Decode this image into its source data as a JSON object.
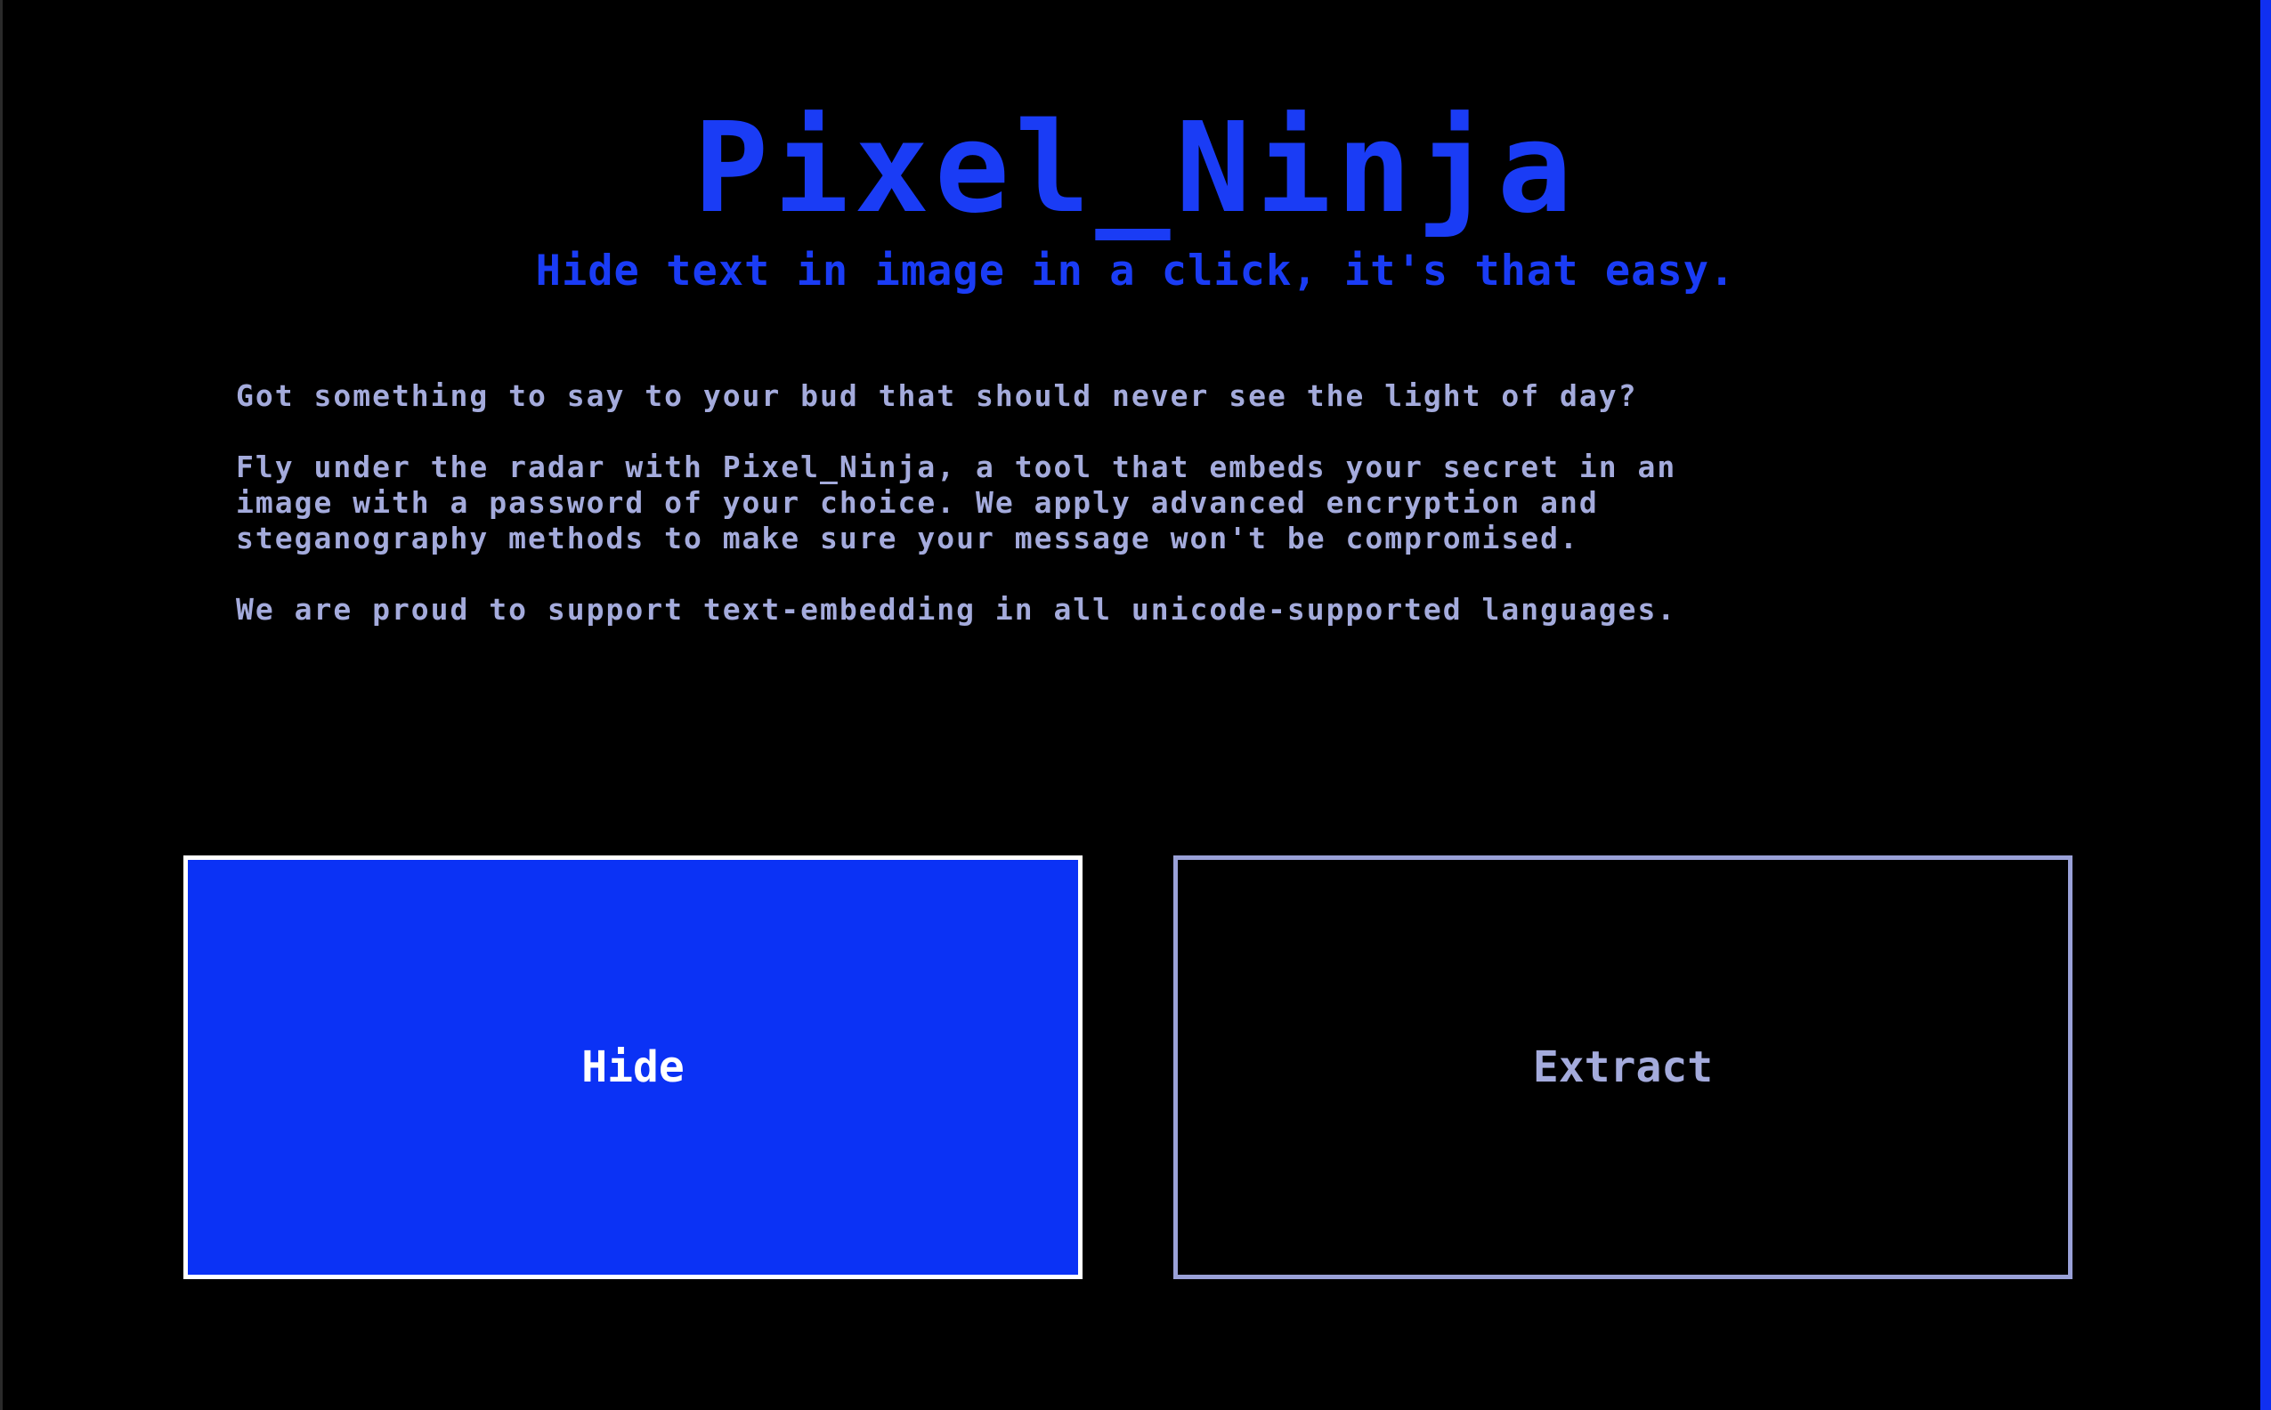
{
  "app": {
    "title": "Pixel_Ninja",
    "tagline": "Hide text in image in a click, it's that easy."
  },
  "intro": {
    "paragraphs": [
      "Got something to say to your bud that should never see the light of day?",
      "Fly under the radar with Pixel_Ninja, a tool that embeds your secret in an\nimage with a password of your choice. We apply advanced encryption and\nsteganography methods to make sure your message won't be compromised.",
      "We are proud to support text-embedding in all unicode-supported languages."
    ]
  },
  "actions": {
    "hide_label": "Hide",
    "extract_label": "Extract"
  },
  "colors": {
    "background": "#000000",
    "accent": "#1a3cf5",
    "primary_button": "#0b32f5",
    "text": "#a4abdc",
    "outline": "#9aa1d8"
  }
}
